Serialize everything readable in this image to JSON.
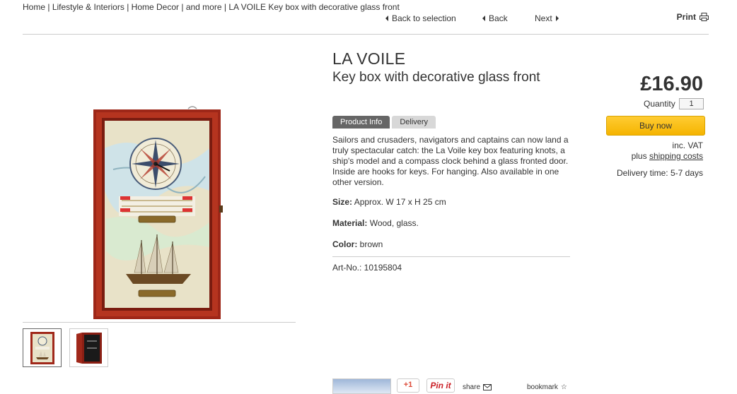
{
  "breadcrumb": {
    "items": [
      "Home |",
      "Lifestyle & Interiors |",
      "Home Decor |",
      "and more |",
      "LA VOILE Key box with decorative glass front"
    ]
  },
  "nav": {
    "back_to_selection": "Back to selection",
    "back": "Back",
    "next": "Next",
    "print": "Print"
  },
  "product": {
    "brand": "LA VOILE",
    "title": "Key box with decorative glass front",
    "description": "Sailors and crusaders, navigators and captains can now land a truly spectacular catch: the La Voile key box featuring knots, a ship's model and a compass clock behind a glass fronted door. Inside are hooks for keys. For hanging. Also available in one other version.",
    "size_label": "Size:",
    "size_value": "Approx. W 17 x H 25 cm",
    "material_label": "Material:",
    "material_value": "Wood, glass.",
    "color_label": "Color:",
    "color_value": "brown",
    "art_no": "Art-No.: 10195804"
  },
  "tabs": [
    {
      "label": "Product Info",
      "active": true
    },
    {
      "label": "Delivery",
      "active": false
    }
  ],
  "purchase": {
    "price": "£16.90",
    "quantity_label": "Quantity",
    "quantity_value": "1",
    "buy_label": "Buy now",
    "vat": "inc. VAT",
    "plus": "plus",
    "shipping_link": "shipping costs",
    "delivery_time": "Delivery time: 5-7 days"
  },
  "social": {
    "gplus": "+1",
    "pinit": "Pin it",
    "share": "share",
    "bookmark": "bookmark"
  },
  "colors": {
    "buy_button": "#f5b400",
    "tab_active": "#666666",
    "frame_wood": "#a0281a"
  }
}
